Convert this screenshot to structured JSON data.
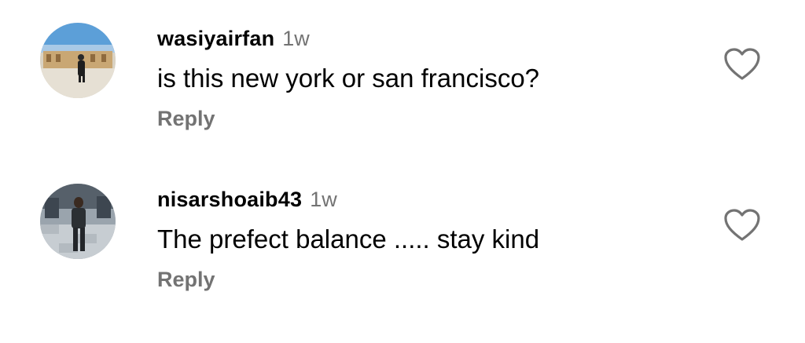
{
  "comments": [
    {
      "username": "wasiyairfan",
      "time": "1w",
      "text": "is this new york or san francisco?",
      "reply_label": "Reply",
      "like_icon": "heart-outline-icon"
    },
    {
      "username": "nisarshoaib43",
      "time": "1w",
      "text": "The prefect balance ..... stay kind",
      "reply_label": "Reply",
      "like_icon": "heart-outline-icon"
    }
  ]
}
